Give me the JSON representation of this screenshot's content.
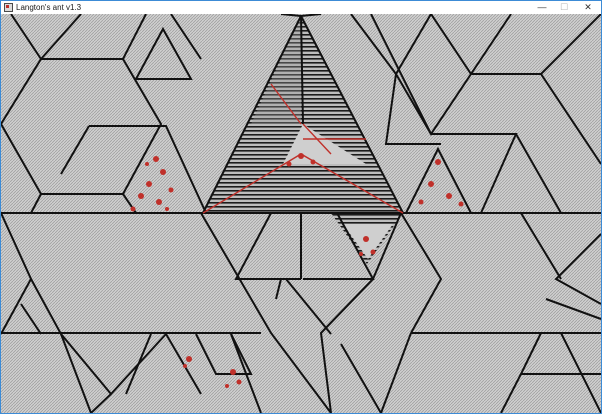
{
  "window": {
    "title": "Langton's ant v1.3",
    "controls": {
      "minimize": "—",
      "maximize": "☐",
      "close": "✕"
    }
  },
  "colors": {
    "accent_border": "#3c8bd6",
    "cell_light": "#cfcfcf",
    "cell_dark": "#9a9a9a",
    "line_dark": "#111111",
    "ant_trail": "#c0302a"
  },
  "icons": {
    "app": "langtons-ant-app-icon",
    "minimize": "minimize-icon",
    "maximize": "maximize-icon",
    "close": "close-icon"
  }
}
